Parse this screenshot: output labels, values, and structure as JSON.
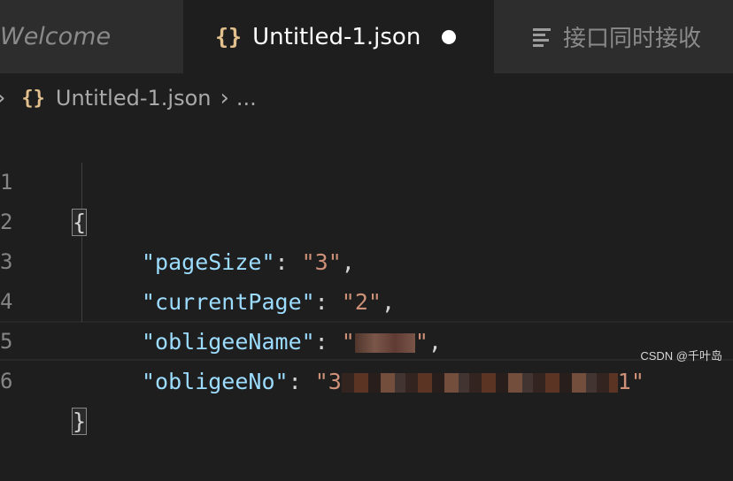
{
  "tabs": {
    "welcome": "Welcome",
    "active": "Untitled-1.json",
    "third": "接口同时接收"
  },
  "breadcrumb": {
    "file": "Untitled-1.json",
    "more": "..."
  },
  "editor": {
    "lines": [
      {
        "num": "1"
      },
      {
        "num": "2",
        "key": "\"pageSize\"",
        "value": "\"3\""
      },
      {
        "num": "3",
        "key": "\"currentPage\"",
        "value": "\"2\""
      },
      {
        "num": "4",
        "key": "\"obligeeName\"",
        "value_start": "\"",
        "value_end": "\""
      },
      {
        "num": "5",
        "key": "\"obligeeNo\"",
        "value_start": "\"3",
        "value_end": "1\""
      },
      {
        "num": "6"
      }
    ],
    "open_brace": "{",
    "close_brace": "}"
  },
  "watermark": "CSDN @千叶岛",
  "colors": {
    "background": "#1e1e1e",
    "key": "#9cdcfe",
    "string": "#ce9178",
    "json_icon": "#e2c08d"
  }
}
